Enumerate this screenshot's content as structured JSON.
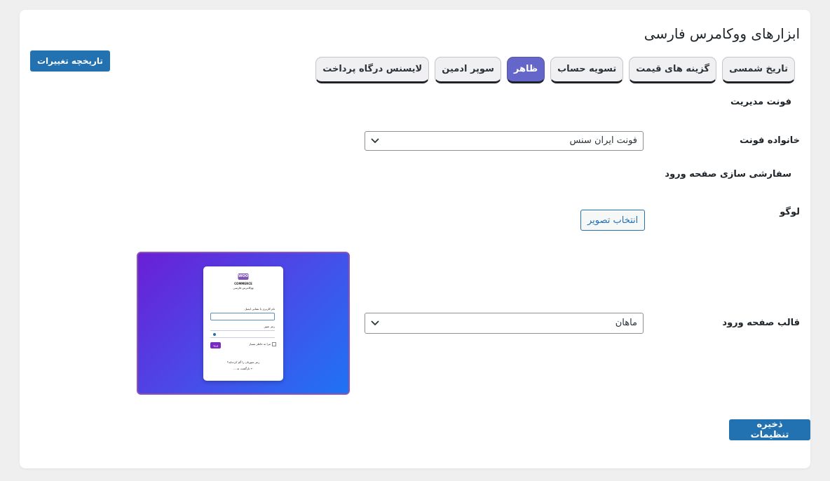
{
  "page": {
    "title": "ابزارهای ووکامرس فارسی"
  },
  "header": {
    "history_button": "تاریخچه تغییرات"
  },
  "tabs": [
    {
      "label": "تاریخ شمسی",
      "active": false
    },
    {
      "label": "گزینه های قیمت",
      "active": false
    },
    {
      "label": "تسویه حساب",
      "active": false
    },
    {
      "label": "ظاهر",
      "active": true
    },
    {
      "label": "سوپر ادمین",
      "active": false
    },
    {
      "label": "لایسنس درگاه پرداخت",
      "active": false
    }
  ],
  "admin_font": {
    "heading": "فونت مدیریت",
    "family_label": "خانواده فونت",
    "family_value": "فونت ایران سنس"
  },
  "login_customization": {
    "heading": "سفارشی سازی صفحه ورود",
    "logo_label": "لوگو",
    "choose_image_button": "انتخاب تصویر",
    "template_label": "قالب صفحه ورود",
    "template_value": "ماهان"
  },
  "preview": {
    "logo_text": "WOO",
    "brand_line1": "COMMERCE",
    "brand_line2": "ووکامرس فارسی",
    "username_label": "نام کاربری یا نشانی ایمیل",
    "password_label": "رمز عبور",
    "remember_label": "مرا به خاطر بسپار",
    "login_button": "ورود",
    "lost_password": "رمز عبورتان را گم کرده‌اید؟",
    "back_link": "← بازگشت به ..."
  },
  "footer": {
    "save_button": "ذخیره تنظیمات"
  },
  "colors": {
    "primary": "#2271b1",
    "active_tab": "#6466c9",
    "preview_border": "#8e54b4"
  }
}
